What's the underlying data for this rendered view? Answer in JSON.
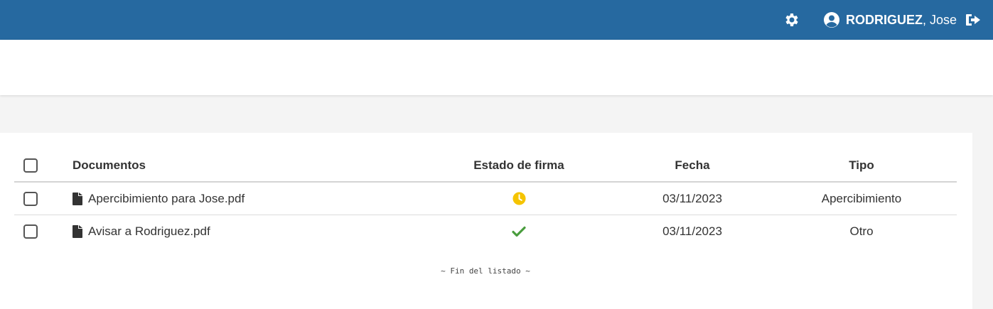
{
  "header": {
    "user_last": "RODRIGUEZ",
    "user_first": ", Jose",
    "icons": {
      "settings": "gear-icon",
      "user": "user-circle-icon",
      "logout": "sign-out-icon"
    },
    "color": "#2669a0"
  },
  "table": {
    "columns": {
      "documentos": "Documentos",
      "estado": "Estado de firma",
      "fecha": "Fecha",
      "tipo": "Tipo"
    },
    "rows": [
      {
        "name": "Apercibimiento para Jose.pdf",
        "status": "pending",
        "status_icon": "clock-icon",
        "status_color": "#f5c400",
        "date": "03/11/2023",
        "type": "Apercibimiento"
      },
      {
        "name": "Avisar a Rodriguez.pdf",
        "status": "signed",
        "status_icon": "check-icon",
        "status_color": "#4a9d3e",
        "date": "03/11/2023",
        "type": "Otro"
      }
    ]
  },
  "footer_text": "~ Fin del listado ~"
}
